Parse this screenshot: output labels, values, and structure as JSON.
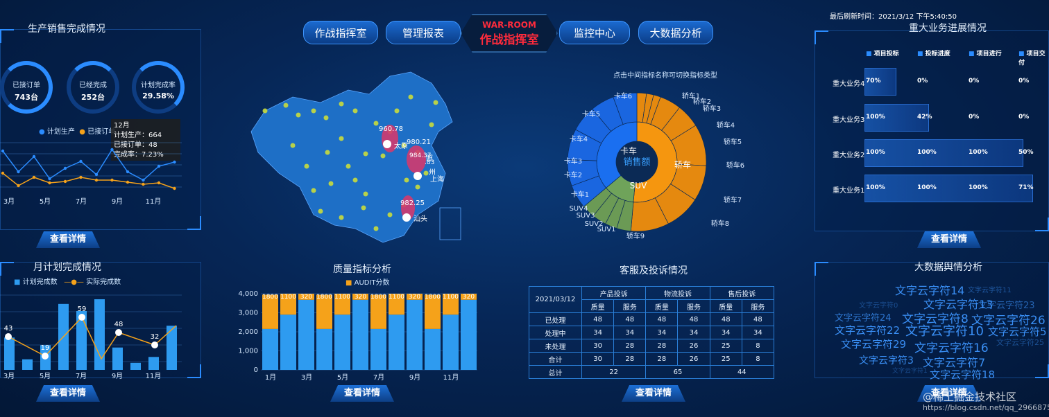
{
  "nav": {
    "left": [
      "作战指挥室",
      "管理报表"
    ],
    "center_en": "WAR-ROOM",
    "center_cn": "作战指挥室",
    "right": [
      "监控中心",
      "大数据分析"
    ]
  },
  "refresh": "最后刷新时间：2021/3/12 下午5:40:50",
  "detail_label": "查看详情",
  "prod": {
    "title": "生产销售完成情况",
    "rings": [
      {
        "label": "已接订单",
        "value": "743台",
        "pct": 0.9
      },
      {
        "label": "已经完成",
        "value": "252台",
        "pct": 0.34
      },
      {
        "label": "计划完成率",
        "value": "29.58%",
        "pct": 0.3
      }
    ],
    "legend": [
      "计划生产",
      "已接订单"
    ],
    "tooltip": {
      "month": "12月",
      "plan": "计划生产：664",
      "order": "已接订单：48",
      "rate": "完成率：7.23%"
    },
    "xticks": [
      "3月",
      "5月",
      "7月",
      "9月",
      "11月"
    ],
    "blue": [
      60,
      30,
      52,
      20,
      35,
      45,
      26,
      62,
      30,
      18,
      38,
      44
    ],
    "orange": [
      28,
      10,
      22,
      14,
      16,
      22,
      18,
      18,
      15,
      12,
      14,
      6
    ]
  },
  "monthly": {
    "title": "月计划完成情况",
    "legend": [
      "计划完成数",
      "实际完成数"
    ],
    "xticks": [
      "3月",
      "5月",
      "7月",
      "9月",
      "11月"
    ],
    "bars": [
      55,
      18,
      42,
      112,
      100,
      120,
      38,
      12,
      22,
      75
    ],
    "line": [
      43,
      19,
      59,
      0,
      48,
      32
    ],
    "line_labels": [
      "43",
      "19",
      "59",
      "48",
      "32"
    ]
  },
  "map": {
    "subtitle": "点击中间指标名称可切换指标类型",
    "cities": [
      {
        "name": "太原",
        "val": "960.78"
      },
      {
        "name": "上海",
        "val": "980.21"
      },
      {
        "name": "汕头",
        "val": "982.25"
      }
    ],
    "extras": [
      "照",
      "州",
      "984.37",
      ".83"
    ]
  },
  "quality": {
    "title": "质量指标分析",
    "legend": "AUDIT分数",
    "yticks": [
      "4,000",
      "3,000",
      "2,000",
      "1,000",
      "0"
    ],
    "xticks": [
      "1月",
      "3月",
      "5月",
      "7月",
      "9月",
      "11月"
    ],
    "bottom": [
      2150,
      2900,
      3680,
      2150,
      2900,
      3680,
      2150,
      2900,
      3680,
      2150,
      2900,
      3680
    ],
    "top_labels": [
      "1800",
      "1100",
      "320",
      "1800",
      "1100",
      "320",
      "1800",
      "1100",
      "320",
      "1800",
      "1100",
      "320"
    ]
  },
  "sunburst": {
    "center": "销售额",
    "inner": [
      "卡车",
      "轿车",
      "SUV"
    ],
    "labels_left": [
      "卡车6",
      "卡车5",
      "卡车4",
      "卡车3",
      "卡车2",
      "卡车1",
      "SUV4",
      "SUV3",
      "SUV2",
      "SUV1"
    ],
    "labels_right": [
      "轿车1",
      "轿车2",
      "轿车3",
      "轿车4",
      "轿车5",
      "轿车6",
      "轿车7",
      "轿车8",
      "轿车9"
    ]
  },
  "complaints": {
    "title": "客服及投诉情况",
    "date": "2021/03/12",
    "groups": [
      "产品投诉",
      "物流投诉",
      "售后投诉"
    ],
    "sub": [
      "质量",
      "服务"
    ],
    "rows": [
      {
        "label": "已处理",
        "v": [
          "48",
          "48",
          "48",
          "48",
          "48",
          "48"
        ]
      },
      {
        "label": "处理中",
        "v": [
          "34",
          "34",
          "34",
          "34",
          "34",
          "34"
        ]
      },
      {
        "label": "未处理",
        "v": [
          "30",
          "28",
          "28",
          "26",
          "25",
          "8"
        ]
      },
      {
        "label": "合计",
        "v": [
          "30",
          "28",
          "28",
          "26",
          "25",
          "8"
        ]
      }
    ],
    "total": {
      "label": "总计",
      "v": [
        "22",
        "65",
        "44"
      ]
    }
  },
  "progress": {
    "title": "重大业务进展情况",
    "cols": [
      "项目投标",
      "投标进度",
      "项目进行",
      "项目交付"
    ],
    "rows": [
      {
        "name": "重大业务4",
        "v": [
          "70%",
          "0%",
          "0%",
          "0%"
        ]
      },
      {
        "name": "重大业务3",
        "v": [
          "100%",
          "42%",
          "0%",
          "0%"
        ]
      },
      {
        "name": "重大业务2",
        "v": [
          "100%",
          "100%",
          "100%",
          "50%"
        ]
      },
      {
        "name": "重大业务1",
        "v": [
          "100%",
          "100%",
          "100%",
          "71%"
        ]
      }
    ]
  },
  "bigdata": {
    "title": "大数据舆情分析",
    "words": [
      "文字云字符14",
      "文字云字符11",
      "文字云字符0",
      "文字云字符13",
      "文字云字符23",
      "文字云字符24",
      "文字云字符8",
      "文字云字符26",
      "文字云字符22",
      "文字云字符10",
      "文字云字符5",
      "文字云字符29",
      "文字云字符16",
      "文字云字符25",
      "文字云字符3",
      "文字云字符7",
      "文字云字符1",
      "文字云字符18"
    ]
  },
  "watermark": "@稀土掘金技术社区",
  "watermark_url": "https://blog.csdn.net/qq_29668759",
  "colors": {
    "accent": "#2b8cff",
    "orange": "#f5a21a",
    "blue": "#2e9bf0",
    "red": "#ff2b3c"
  }
}
